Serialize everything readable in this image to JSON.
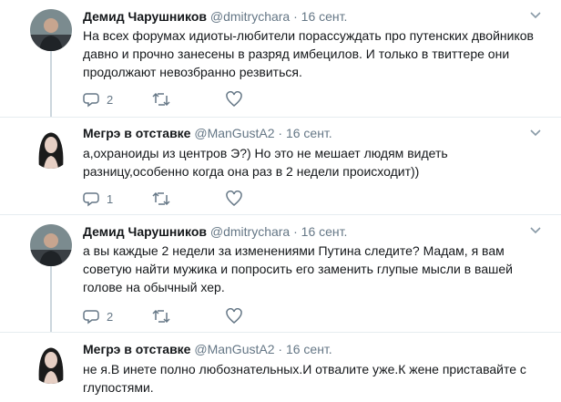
{
  "tweets": [
    {
      "name": "Демид Чарушников",
      "handle": "@dmitrychara",
      "dot": "·",
      "date": "16 сент.",
      "text": "На всех форумах идиоты-любители порассуждать про путенских двойников давно и прочно занесены в разряд имбецилов. И только в твиттере они продолжают невозбранно резвиться.",
      "replies": "2",
      "avatar_icon": "man-avatar-icon"
    },
    {
      "name": "Мегрэ в отставке",
      "handle": "@ManGustA2",
      "dot": "·",
      "date": "16 сент.",
      "text": "а,охраноиды из центров Э?) Но это не мешает людям видеть разницу,особенно когда она раз в 2 недели происходит))",
      "replies": "1",
      "avatar_icon": "woman-avatar-icon"
    },
    {
      "name": "Демид Чарушников",
      "handle": "@dmitrychara",
      "dot": "·",
      "date": "16 сент.",
      "text": "а вы каждые 2 недели за изменениями Путина следите? Мадам, я вам советую найти мужика и попросить его заменить глупые мысли в вашей голове на обычный хер.",
      "replies": "2",
      "avatar_icon": "man-avatar-icon"
    },
    {
      "name": "Мегрэ в отставке",
      "handle": "@ManGustA2",
      "dot": "·",
      "date": "16 сент.",
      "text": "не я.В инете полно любознательных.И отвалите уже.К жене приставайте с глупостями.",
      "avatar_icon": "woman-avatar-icon"
    }
  ],
  "colors": {
    "text": "#14171a",
    "secondary": "#657786",
    "thread_line": "#ccd6dd",
    "divider": "#e6ecf0"
  }
}
